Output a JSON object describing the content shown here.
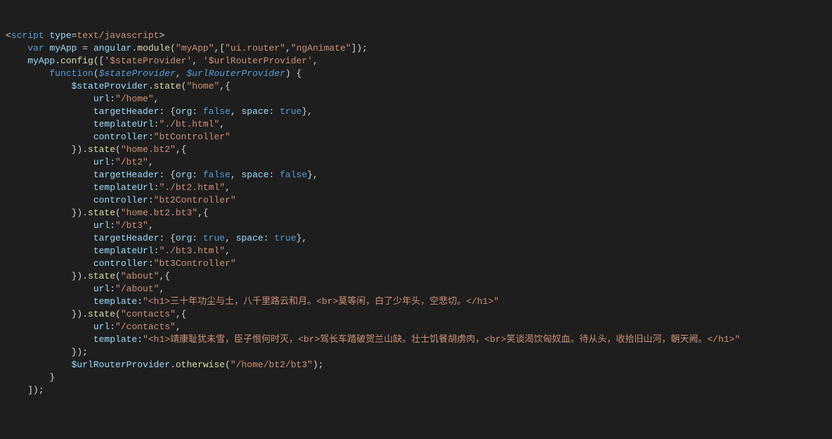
{
  "code": {
    "scriptType": "text/javascript",
    "varKw": "var",
    "myApp": "myApp",
    "eq": " = ",
    "angular": "angular",
    "module": "module",
    "appName": "\"myApp\"",
    "dep1": "\"ui.router\"",
    "dep2": "\"ngAnimate\"",
    "config": "config",
    "sp": "'$stateProvider'",
    "urp": "'$urlRouterProvider'",
    "funcKw": "function",
    "p1": "$stateProvider",
    "p2": "$urlRouterProvider",
    "stateFn": "state",
    "otherwiseFn": "otherwise",
    "urlKey": "url",
    "targetHeaderKey": "targetHeader",
    "orgKey": "org",
    "spaceKey": "space",
    "templateUrlKey": "templateUrl",
    "controllerKey": "controller",
    "templateKey": "template",
    "trueLit": "true",
    "falseLit": "false",
    "homeName": "\"home\"",
    "homeUrl": "\"/home\"",
    "homeTpl": "\"./bt.html\"",
    "homeCtrl": "\"btController\"",
    "bt2Name": "\"home.bt2\"",
    "bt2Url": "\"/bt2\"",
    "bt2Tpl": "\"./bt2.html\"",
    "bt2Ctrl": "\"bt2Controller\"",
    "bt3Name": "\"home.bt2.bt3\"",
    "bt3Url": "\"/bt3\"",
    "bt3Tpl": "\"./bt3.html\"",
    "bt3Ctrl": "\"bt3Controller\"",
    "aboutName": "\"about\"",
    "aboutUrl": "\"/about\"",
    "aboutTplStr": "\"<h1>三十年功尘与土，八千里路云和月。<br>莫等闲，白了少年头，空悲切。</h1>\"",
    "contactsName": "\"contacts\"",
    "contactsUrl": "\"/contacts\"",
    "contactsTplStr": "\"<h1>靖康耻犹未雪，臣子恨何时灭，<br>驾长车踏破贺兰山缺。壮士饥餐胡虏肉，<br>笑谈渴饮匈奴血。待从头，收拾旧山河，朝天阙。</h1>\"",
    "otherwisePath": "\"/home/bt2/bt3\""
  }
}
